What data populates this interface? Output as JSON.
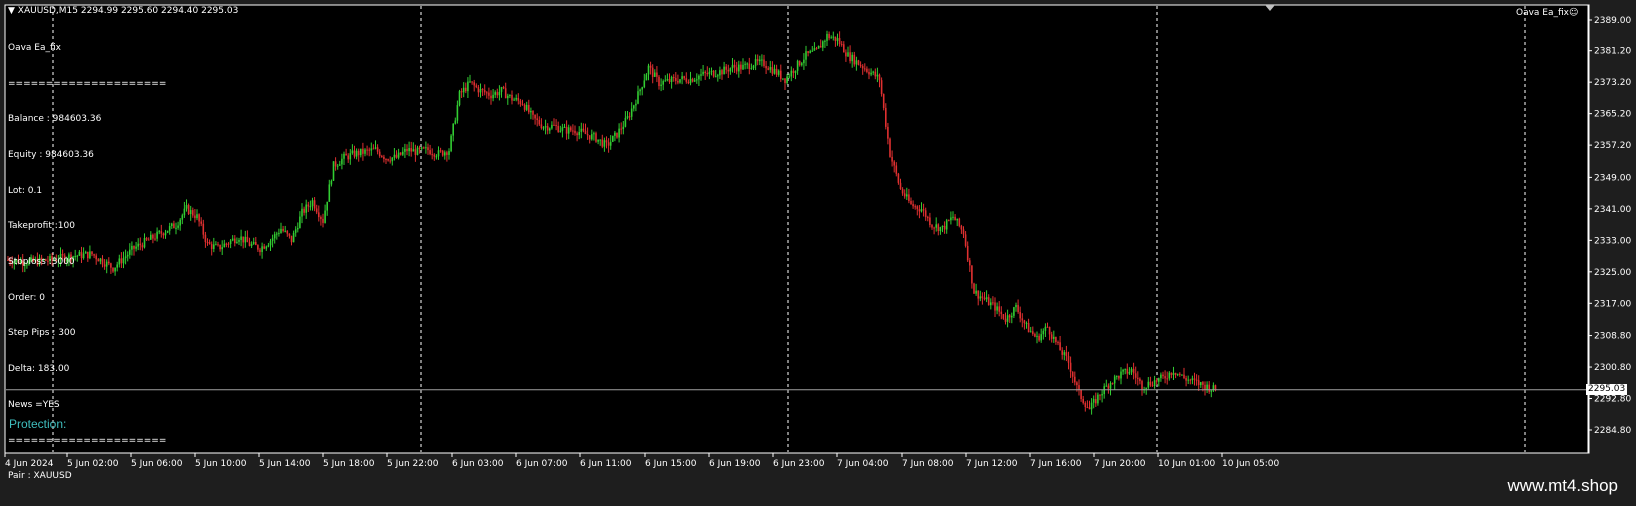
{
  "header": {
    "symbol_line": "▼ XAUUSD,M15  2294.99 2295.60 2294.40 2295.03",
    "ea_name": "Oava Ea_fix"
  },
  "ea_panel": {
    "lines": [
      "Oava Ea_fix",
      "=====================",
      "Balance : 984603.36",
      "Equity : 984603.36",
      "Lot: 0.1",
      "Takeprofit :100",
      "Stoploss :3000",
      "Order: 0",
      "Step Pips : 300",
      "Delta: 183.00",
      "News =YES",
      "=====================",
      "Pair : XAUUSD"
    ]
  },
  "protection_label": "Protection:",
  "current_price": "2295.03",
  "watermark": "www.mt4.shop",
  "colors": {
    "background": "#000000",
    "bull": "#32cd32",
    "bear": "#e03030",
    "grid": "#ffffff",
    "price_line": "#a0a0a0"
  },
  "chart_data": {
    "type": "candlestick",
    "symbol": "XAUUSD",
    "timeframe": "M15",
    "ylim": [
      2284.8,
      2389.0
    ],
    "yticks": [
      "2389.00",
      "2381.20",
      "2373.20",
      "2365.20",
      "2357.20",
      "2349.00",
      "2341.00",
      "2333.00",
      "2325.00",
      "2317.00",
      "2308.80",
      "2300.80",
      "2292.80",
      "2284.80"
    ],
    "xticks": [
      "4 Jun 2024",
      "5 Jun 02:00",
      "5 Jun 06:00",
      "5 Jun 10:00",
      "5 Jun 14:00",
      "5 Jun 18:00",
      "5 Jun 22:00",
      "6 Jun 03:00",
      "6 Jun 07:00",
      "6 Jun 11:00",
      "6 Jun 15:00",
      "6 Jun 19:00",
      "6 Jun 23:00",
      "7 Jun 04:00",
      "7 Jun 08:00",
      "7 Jun 12:00",
      "7 Jun 16:00",
      "7 Jun 20:00",
      "10 Jun 01:00",
      "10 Jun 05:00"
    ],
    "last_price": 2295.03,
    "close_path": [
      [
        0,
        2328
      ],
      [
        10,
        2327.5
      ],
      [
        20,
        2328
      ],
      [
        30,
        2329
      ],
      [
        40,
        2329.5
      ],
      [
        50,
        2326
      ],
      [
        60,
        2331
      ],
      [
        70,
        2334
      ],
      [
        80,
        2337
      ],
      [
        85,
        2341
      ],
      [
        90,
        2339
      ],
      [
        95,
        2332
      ],
      [
        100,
        2331
      ],
      [
        110,
        2334
      ],
      [
        115,
        2332
      ],
      [
        120,
        2331
      ],
      [
        125,
        2333
      ],
      [
        130,
        2336
      ],
      [
        135,
        2333
      ],
      [
        140,
        2340
      ],
      [
        145,
        2343
      ],
      [
        150,
        2338
      ],
      [
        155,
        2352
      ],
      [
        160,
        2354
      ],
      [
        165,
        2355
      ],
      [
        170,
        2355.5
      ],
      [
        175,
        2356
      ],
      [
        180,
        2354
      ],
      [
        185,
        2354
      ],
      [
        190,
        2356
      ],
      [
        195,
        2355.5
      ],
      [
        200,
        2356
      ],
      [
        205,
        2355
      ],
      [
        210,
        2356
      ],
      [
        215,
        2370
      ],
      [
        220,
        2373
      ],
      [
        225,
        2371
      ],
      [
        230,
        2370
      ],
      [
        235,
        2371
      ],
      [
        240,
        2369
      ],
      [
        245,
        2368
      ],
      [
        250,
        2364
      ],
      [
        255,
        2362
      ],
      [
        260,
        2362
      ],
      [
        265,
        2361
      ],
      [
        270,
        2361
      ],
      [
        275,
        2360
      ],
      [
        280,
        2359
      ],
      [
        285,
        2357
      ],
      [
        290,
        2360
      ],
      [
        295,
        2364
      ],
      [
        300,
        2370
      ],
      [
        305,
        2377
      ],
      [
        310,
        2373
      ],
      [
        315,
        2373.5
      ],
      [
        320,
        2374
      ],
      [
        325,
        2374
      ],
      [
        330,
        2375
      ],
      [
        335,
        2375.5
      ],
      [
        340,
        2376
      ],
      [
        345,
        2377
      ],
      [
        350,
        2377
      ],
      [
        355,
        2378
      ],
      [
        360,
        2378
      ],
      [
        365,
        2376
      ],
      [
        370,
        2374
      ],
      [
        375,
        2377
      ],
      [
        380,
        2380
      ],
      [
        385,
        2381
      ],
      [
        390,
        2385
      ],
      [
        395,
        2384
      ],
      [
        400,
        2380
      ],
      [
        405,
        2378
      ],
      [
        410,
        2376
      ],
      [
        415,
        2374
      ],
      [
        420,
        2355
      ],
      [
        425,
        2346
      ],
      [
        430,
        2342
      ],
      [
        435,
        2341
      ],
      [
        440,
        2337
      ],
      [
        445,
        2336
      ],
      [
        450,
        2339
      ],
      [
        455,
        2335
      ],
      [
        460,
        2320
      ],
      [
        465,
        2318
      ],
      [
        470,
        2316
      ],
      [
        475,
        2313
      ],
      [
        480,
        2316
      ],
      [
        485,
        2311
      ],
      [
        490,
        2308
      ],
      [
        495,
        2311
      ],
      [
        500,
        2306
      ],
      [
        505,
        2302
      ],
      [
        510,
        2294
      ],
      [
        515,
        2290
      ],
      [
        520,
        2294
      ],
      [
        525,
        2297
      ],
      [
        530,
        2299
      ],
      [
        535,
        2300
      ],
      [
        540,
        2296
      ],
      [
        545,
        2297
      ],
      [
        550,
        2298
      ],
      [
        555,
        2300
      ],
      [
        560,
        2298
      ],
      [
        565,
        2297
      ],
      [
        570,
        2296
      ],
      [
        575,
        2295
      ]
    ]
  }
}
